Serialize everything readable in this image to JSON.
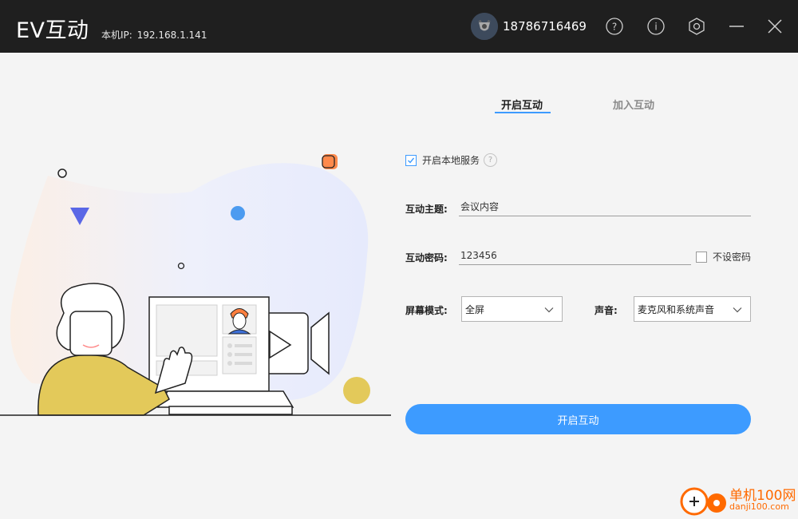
{
  "titlebar": {
    "app_title": "EV互动",
    "ip_label": "本机IP:",
    "ip_value": "192.168.1.141",
    "phone": "18786716469",
    "icons": [
      "help-icon",
      "info-icon",
      "settings-icon",
      "minimize-icon",
      "close-icon"
    ],
    "help_glyph": "?",
    "info_glyph": "i"
  },
  "tabs": [
    {
      "label": "开启互动",
      "active": true
    },
    {
      "label": "加入互动",
      "active": false
    }
  ],
  "form": {
    "local_service": {
      "label": "开启本地服务",
      "checked": true,
      "help_glyph": "?"
    },
    "topic": {
      "label": "互动主题:",
      "value": "会议内容"
    },
    "password": {
      "label": "互动密码:",
      "value": "123456"
    },
    "no_password": {
      "label": "不设密码",
      "checked": false
    },
    "screen_mode": {
      "label": "屏幕模式:",
      "selected": "全屏"
    },
    "sound": {
      "label": "声音:",
      "selected": "麦克风和系统声音"
    },
    "submit_label": "开启互动"
  },
  "watermark": {
    "name": "单机100网",
    "url": "danji100.com"
  },
  "colors": {
    "titlebar_bg": "#1f1f1f",
    "accent": "#3d9bff",
    "page_bg": "#f4f4f4",
    "watermark": "#ff6a00",
    "illustration_yellow": "#e3c95a",
    "illustration_blue_triangle": "#5a67e6",
    "illustration_orange": "#ff8a4c"
  }
}
